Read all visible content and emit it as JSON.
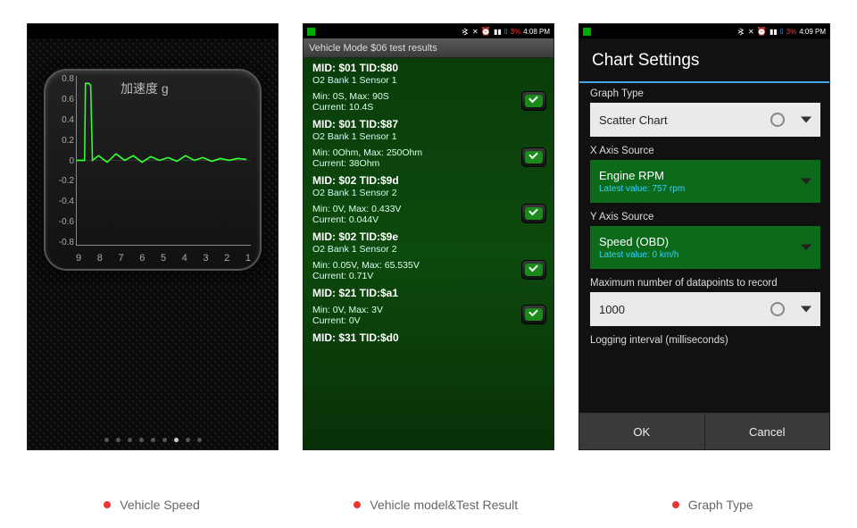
{
  "status": {
    "battery_pct": "3%",
    "time_a": "4:08 PM",
    "time_b": "4:09 PM"
  },
  "captions": {
    "a": "Vehicle Speed",
    "b": "Vehicle model&Test Result",
    "c": "Graph Type"
  },
  "panel1": {
    "title": "加速度 g",
    "y_ticks": [
      "0.8",
      "0.6",
      "0.4",
      "0.2",
      "0",
      "-0.2",
      "-0.4",
      "-0.6",
      "-0.8"
    ],
    "x_ticks": [
      "9",
      "8",
      "7",
      "6",
      "5",
      "4",
      "3",
      "2",
      "1"
    ],
    "pager_count": 9,
    "pager_active": 6
  },
  "chart_data": {
    "type": "line",
    "title": "加速度 g",
    "xlabel": "",
    "ylabel": "",
    "ylim": [
      -0.9,
      0.9
    ],
    "x": [
      9.0,
      8.8,
      8.75,
      8.7,
      8.6,
      8.55,
      8.5,
      8.3,
      8.0,
      7.5,
      7.0,
      6.5,
      6.0,
      5.5,
      5.0,
      4.5,
      4.0,
      3.5,
      3.0,
      2.5,
      2.0,
      1.5,
      1.0
    ],
    "values": [
      0.0,
      0.0,
      0.0,
      0.82,
      0.82,
      0.8,
      0.0,
      0.05,
      0.02,
      0.06,
      0.03,
      0.05,
      0.02,
      0.04,
      0.03,
      0.05,
      0.02,
      0.04,
      0.03,
      0.03,
      0.02,
      0.03,
      0.03
    ],
    "note": "x axis runs right-to-left (9→1). Spike near x≈8.7 to ~0.82 g, otherwise near 0."
  },
  "panel2": {
    "header": "Vehicle Mode $06 test results",
    "rows": [
      {
        "h": "MID: $01 TID:$80",
        "sub": "O2 Bank 1 Sensor 1",
        "mm": "Min: 0S, Max: 90S",
        "cur": "Current: 10.4S"
      },
      {
        "h": "MID: $01 TID:$87",
        "sub": "O2 Bank 1 Sensor 1",
        "mm": "Min: 0Ohm, Max: 250Ohm",
        "cur": "Current: 38Ohm"
      },
      {
        "h": "MID: $02 TID:$9d",
        "sub": "O2 Bank 1 Sensor 2",
        "mm": "Min: 0V, Max: 0.433V",
        "cur": "Current: 0.044V"
      },
      {
        "h": "MID: $02 TID:$9e",
        "sub": "O2 Bank 1 Sensor 2",
        "mm": "Min: 0.05V, Max: 65.535V",
        "cur": "Current: 0.71V"
      },
      {
        "h": "MID: $21 TID:$a1",
        "sub": "",
        "mm": "Min: 0V, Max: 3V",
        "cur": "Current: 0V"
      },
      {
        "h": "MID: $31 TID:$d0",
        "sub": "",
        "mm": "",
        "cur": ""
      }
    ]
  },
  "panel3": {
    "title": "Chart Settings",
    "graph_type_label": "Graph Type",
    "graph_type_value": "Scatter Chart",
    "x_axis_label": "X Axis Source",
    "x_axis_value": "Engine RPM",
    "x_axis_latest": "Latest value: 757 rpm",
    "y_axis_label": "Y Axis Source",
    "y_axis_value": "Speed (OBD)",
    "y_axis_latest": "Latest value: 0 km/h",
    "max_dp_label": "Maximum number of datapoints to record",
    "max_dp_value": "1000",
    "log_int_label": "Logging interval (milliseconds)",
    "ok": "OK",
    "cancel": "Cancel"
  }
}
